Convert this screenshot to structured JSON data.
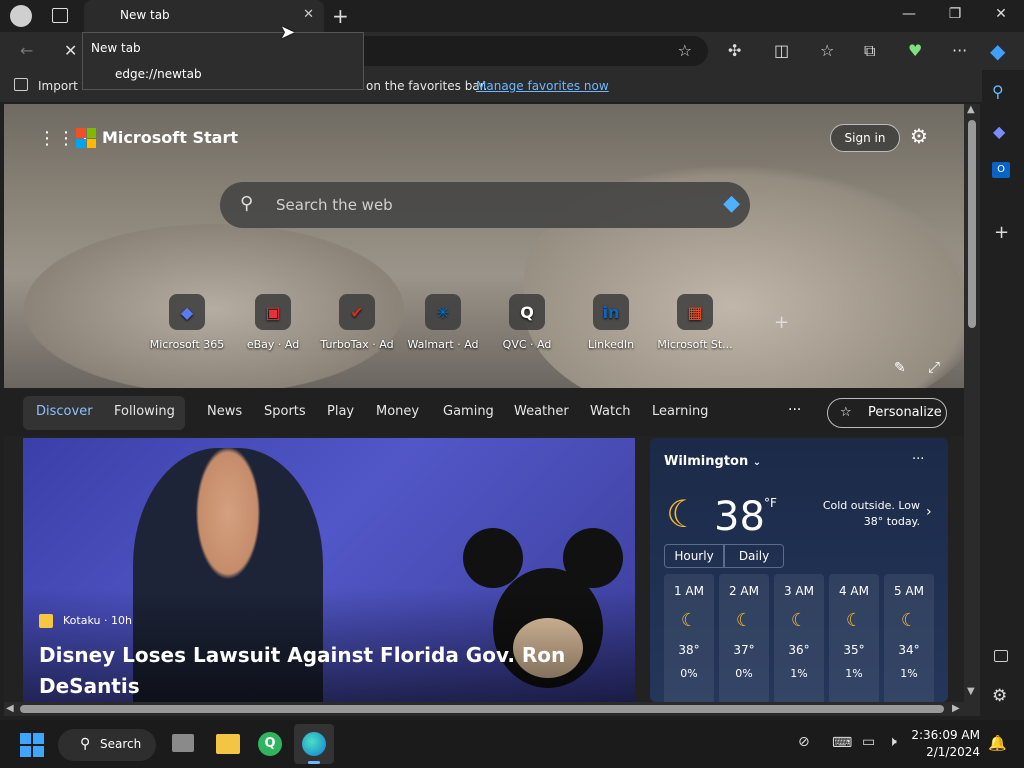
{
  "browser": {
    "tab": {
      "title": "New tab"
    },
    "tooltip": {
      "title": "New tab",
      "url": "edge://newtab"
    },
    "favorites_bar": {
      "import_label": "Import f",
      "middle_text": "on the favorites bar.",
      "manage_link": "Manage favorites now"
    }
  },
  "page": {
    "brand": "Microsoft Start",
    "sign_in": "Sign in",
    "search_placeholder": "Search the web",
    "tiles": [
      {
        "label": "Microsoft 365",
        "glyph": "◆",
        "color": "#5b7cf0"
      },
      {
        "label": "eBay · Ad",
        "glyph": "▣",
        "color": "#e53238"
      },
      {
        "label": "TurboTax · Ad",
        "glyph": "✔",
        "color": "#d52b1e"
      },
      {
        "label": "Walmart · Ad",
        "glyph": "✳",
        "color": "#0071ce"
      },
      {
        "label": "QVC · Ad",
        "glyph": "Q",
        "color": "#ffffff"
      },
      {
        "label": "LinkedIn",
        "glyph": "in",
        "color": "#0a66c2"
      },
      {
        "label": "Microsoft St...",
        "glyph": "▦",
        "color": "#f25022"
      }
    ],
    "feed_nav": {
      "active": "Discover",
      "items": [
        "Discover",
        "Following",
        "News",
        "Sports",
        "Play",
        "Money",
        "Gaming",
        "Weather",
        "Watch",
        "Learning"
      ],
      "more": "···",
      "personalize": "Personalize"
    },
    "news": {
      "source": "Kotaku · 10h",
      "headline": "Disney Loses Lawsuit Against Florida Gov. Ron DeSantis"
    },
    "weather": {
      "location": "Wilmington",
      "temp": "38",
      "unit": "°F",
      "note": "Cold outside. Low 38° today.",
      "tabs": [
        "Hourly",
        "Daily"
      ],
      "hours": [
        {
          "time": "1 AM",
          "temp": "38°",
          "precip": "0%"
        },
        {
          "time": "2 AM",
          "temp": "37°",
          "precip": "0%"
        },
        {
          "time": "3 AM",
          "temp": "36°",
          "precip": "1%"
        },
        {
          "time": "4 AM",
          "temp": "35°",
          "precip": "1%"
        },
        {
          "time": "5 AM",
          "temp": "34°",
          "precip": "1%"
        }
      ]
    }
  },
  "taskbar": {
    "search_label": "Search",
    "time": "2:36:09 AM",
    "date": "2/1/2024"
  }
}
